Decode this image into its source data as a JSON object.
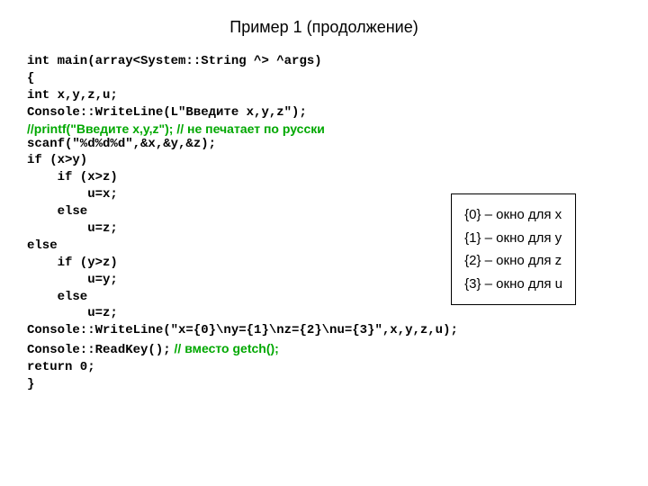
{
  "title": "Пример 1 (продолжение)",
  "code": {
    "line1": "int main(array<System::String ^> ^args)",
    "line2": "{",
    "line3": "int x,y,z,u;",
    "line4": "",
    "line5": "Console::WriteLine(L\"Введите x,y,z\");",
    "comment1": "//printf(\"Введите x,y,z\"); // не печатает по русски",
    "line6": "",
    "line7": "scanf(\"%d%d%d\",&x,&y,&z);",
    "line8": "if (x>y)",
    "line9": "    if (x>z)",
    "line10": "        u=x;",
    "line11": "    else",
    "line12": "        u=z;",
    "line13": "else",
    "line14": "    if (y>z)",
    "line15": "        u=y;",
    "line16": "    else",
    "line17": "        u=z;",
    "line18": "Console::WriteLine(\"x={0}\\ny={1}\\nz={2}\\nu={3}\",x,y,z,u);",
    "line19": "",
    "readkey_mono": "Console::ReadKey();",
    "readkey_comment": " // вместо getch();",
    "line21": "return 0;",
    "line22": "}"
  },
  "infobox": {
    "item0": "{0} – окно для x",
    "item1": "{1} – окно для y",
    "item2": "{2} – окно для z",
    "item3": "{3} – окно для u"
  }
}
